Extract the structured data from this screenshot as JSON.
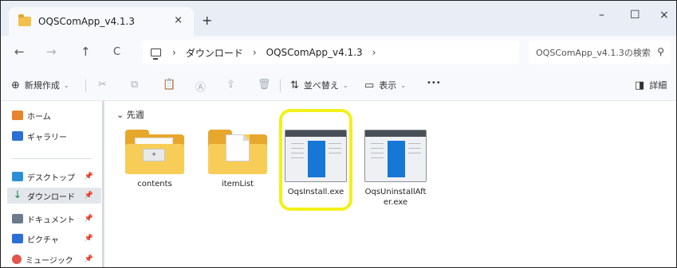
{
  "window": {
    "tab_title": "OQSComApp_v4.1.3",
    "tab_close": "×",
    "tab_new": "+",
    "minimize": "–",
    "maximize": "☐",
    "close": "×"
  },
  "nav": {
    "back": "←",
    "forward": "→",
    "up": "↑",
    "refresh": "C",
    "sep": "›",
    "breadcrumb": [
      "ダウンロード",
      "OQSComApp_v4.1.3"
    ],
    "search_placeholder": "OQSComApp_v4.1.3の検索",
    "search_icon": "⚲"
  },
  "commands": {
    "new": "新規作成",
    "cut": "✂",
    "copy": "⧉",
    "paste": "📋",
    "rename": "Ⓐ",
    "share": "⇪",
    "delete": "🗑",
    "sort": "並べ替え",
    "view": "表示",
    "more": "•••",
    "details": "詳細"
  },
  "sidebar": {
    "items": [
      {
        "label": "ホーム",
        "icon_color": "#e8842c"
      },
      {
        "label": "ギャラリー",
        "icon_color": "#2a6fd6"
      },
      {
        "label": "デスクトップ",
        "icon_color": "#2b8fd8"
      },
      {
        "label": "ダウンロード",
        "icon_color": "#1f8f4e"
      },
      {
        "label": "ドキュメント",
        "icon_color": "#6b7b8c"
      },
      {
        "label": "ピクチャ",
        "icon_color": "#2a6fd6"
      },
      {
        "label": "ミュージック",
        "icon_color": "#e2574c"
      }
    ],
    "pin": "📌"
  },
  "main": {
    "group_header": "先週",
    "files": [
      {
        "name": "contents",
        "type": "folder"
      },
      {
        "name": "itemList",
        "type": "folder"
      },
      {
        "name": "OqsInstall.exe",
        "type": "exe"
      },
      {
        "name": "OqsUninstallAfter.exe",
        "type": "exe"
      }
    ]
  },
  "colors": {
    "highlight": "#f3f01a",
    "folder": "#f8cd57",
    "exe_blue": "#1677d6"
  }
}
